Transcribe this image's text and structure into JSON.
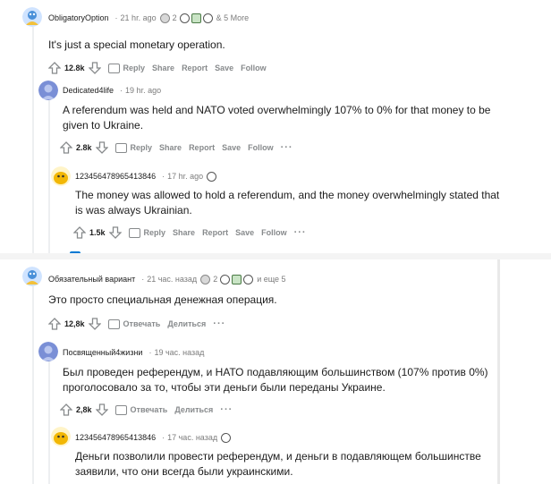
{
  "english": {
    "c1": {
      "username": "ObligatoryOption",
      "time": "21 hr. ago",
      "award_count": "2",
      "more": "& 5 More",
      "body": "It's just a special monetary operation.",
      "score": "12.8k",
      "reply": "Reply",
      "share": "Share",
      "report": "Report",
      "save": "Save",
      "follow": "Follow"
    },
    "c2": {
      "username": "Dedicated4life",
      "time": "19 hr. ago",
      "body_line1": "A referendum was held and NATO voted overwhelmingly 107% to 0% for that money to be",
      "body_line2": "given to Ukraine.",
      "score": "2.8k",
      "reply": "Reply",
      "share": "Share",
      "report": "Report",
      "save": "Save",
      "follow": "Follow",
      "more_options": "···"
    },
    "c3": {
      "username": "123456478965413846",
      "time": "17 hr. ago",
      "body_line1": "The money was allowed to hold a referendum, and the money overwhelmingly stated that",
      "body_line2": "is was always Ukrainian.",
      "score": "1.5k",
      "reply": "Reply",
      "share": "Share",
      "report": "Report",
      "save": "Save",
      "follow": "Follow",
      "more_options": "···"
    }
  },
  "russian": {
    "c1": {
      "username": "Обязательный вариант",
      "time": "21 час. назад",
      "award_count": "2",
      "more": "и еще 5",
      "body": "Это просто специальная денежная операция.",
      "score": "12,8k",
      "reply": "Отвечать",
      "share": "Делиться",
      "more_options": "···"
    },
    "c2": {
      "username": "Посвященный4жизни",
      "time": "19 час. назад",
      "body_line1": "Был проведен референдум, и НАТО подавляющим большинством (107% против 0%)",
      "body_line2": "проголосовало за то, чтобы эти деньги были переданы Украине.",
      "score": "2,8k",
      "reply": "Отвечать",
      "share": "Делиться",
      "more_options": "···"
    },
    "c3": {
      "username": "123456478965413846",
      "time": "17 час. назад",
      "body_line1": "Деньги позволили провести референдум, и деньги в подавляющем большинстве",
      "body_line2": "заявили, что они всегда были украинскими."
    }
  },
  "icons": {
    "upvote": "upvote-icon",
    "downvote": "downvote-icon",
    "comment": "comment-bubble-icon"
  },
  "colors": {
    "text": "#1c1c1c",
    "meta": "#7c7c7c",
    "action": "#878a8c",
    "thread": "#edeff1"
  }
}
